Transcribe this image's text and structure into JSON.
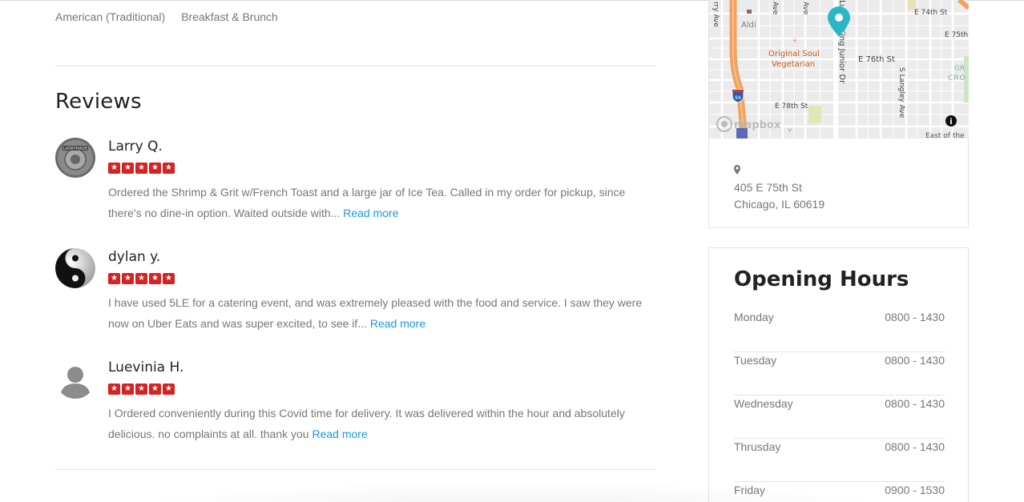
{
  "categories": [
    "American (Traditional)",
    "Breakfast & Brunch"
  ],
  "reviews_heading": "Reviews",
  "reviews": [
    {
      "name": "Larry Q.",
      "rating": 5,
      "text": "Ordered the Shrimp & Grit w/French Toast and a large jar of Ice Tea. Called in my order for pickup, since there's no dine-in option. Waited outside with... ",
      "read_more": "Read more",
      "avatar_text": "LARRYMADE"
    },
    {
      "name": "dylan y.",
      "rating": 5,
      "text": "I have used 5LE for a catering event, and was extremely pleased with the food and service. I saw they were now on Uber Eats and was super excited, to see if... ",
      "read_more": "Read more"
    },
    {
      "name": "Luevinia H.",
      "rating": 5,
      "text": "I Ordered conveniently during this Covid time for delivery. It was delivered within the hour and absolutely delicious. no complaints at all. thank you ",
      "read_more": "Read more"
    }
  ],
  "map": {
    "labels": {
      "aldi": "Aldi",
      "restaurant_line1": "Original Soul",
      "restaurant_line2": "Vegetarian",
      "e74": "E 74th St",
      "e75": "E 75th",
      "e76": "E 76th St",
      "e78": "E 78th St",
      "mlk": "Luther King Junior Dr",
      "langley": "S Langley Ave",
      "ave1": "rry Ave",
      "ave2": "Ave",
      "ave3": "Ave",
      "gr": "GR",
      "cro": "CRO",
      "east": "East of the",
      "interstate": "94",
      "mapbox": "mapbox"
    },
    "colors": {
      "highway": "#f0a35e",
      "pin": "#2ab6c4",
      "poi": "#c65c1f"
    }
  },
  "address": {
    "line1": "405 E 75th St",
    "line2": "Chicago, IL 60619",
    "icon": "map-marker-icon"
  },
  "hours_heading": "Opening Hours",
  "hours": [
    {
      "day": "Monday",
      "time": "0800 - 1430"
    },
    {
      "day": "Tuesday",
      "time": "0800 - 1430"
    },
    {
      "day": "Wednesday",
      "time": "0800 - 1430"
    },
    {
      "day": "Thrusday",
      "time": "0800 - 1430"
    },
    {
      "day": "Friday",
      "time": "0900 - 1530"
    }
  ],
  "colors": {
    "star": "#d32323",
    "link": "#1a9ad9",
    "muted_text": "#777777"
  }
}
